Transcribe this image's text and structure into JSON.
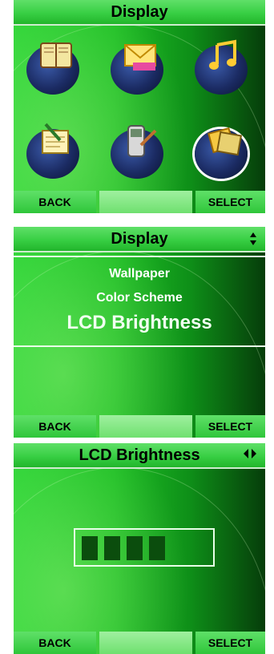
{
  "screen1": {
    "title": "Display",
    "icons": [
      {
        "name": "book-icon"
      },
      {
        "name": "mail-icon"
      },
      {
        "name": "music-icon"
      },
      {
        "name": "notepad-icon"
      },
      {
        "name": "phone-settings-icon"
      },
      {
        "name": "display-photo-icon"
      }
    ],
    "softkeys": {
      "left": "BACK",
      "middle": "",
      "right": "SELECT"
    }
  },
  "screen2": {
    "title": "Display",
    "scroll_indicator_icon": "scroll-updown-icon",
    "items": [
      "Wallpaper",
      "Color Scheme",
      "LCD Brightness"
    ],
    "selected_index": 2,
    "softkeys": {
      "left": "BACK",
      "middle": "",
      "right": "SELECT"
    }
  },
  "screen3": {
    "title": "LCD Brightness",
    "adjust_indicator_icon": "left-right-arrows-icon",
    "brightness_level": 4,
    "softkeys": {
      "left": "BACK",
      "middle": "",
      "right": "SELECT"
    }
  },
  "colors": {
    "accent": "#2bd435",
    "dark": "#063d0a",
    "segment": "#0b4d0d"
  }
}
